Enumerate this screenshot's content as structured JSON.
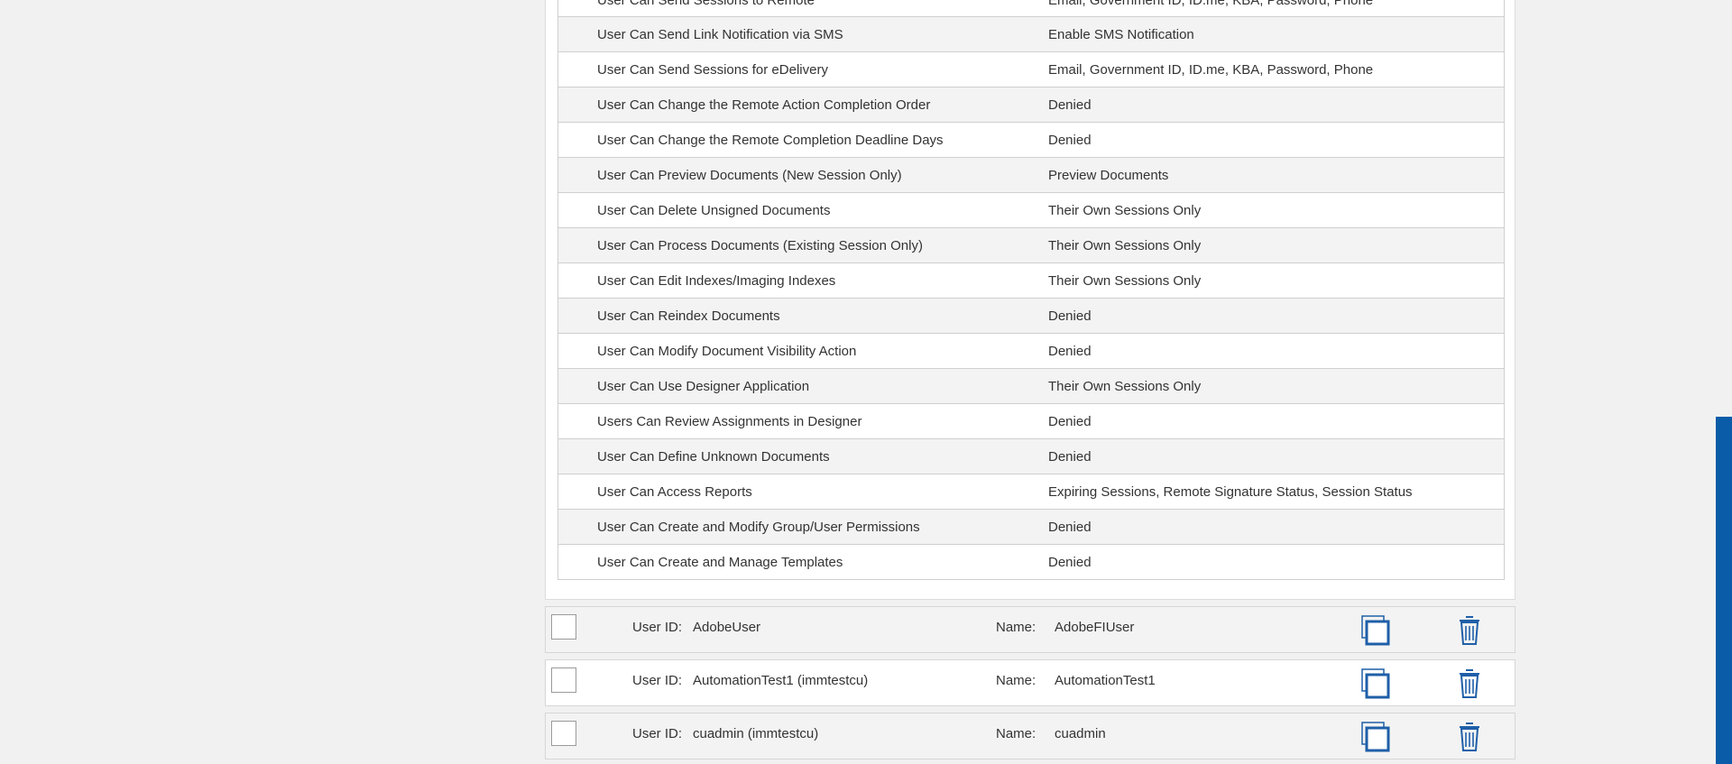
{
  "permissions": [
    {
      "name": "User Can Send Sessions to Remote",
      "value": "Email, Government ID, ID.me, KBA, Password, Phone"
    },
    {
      "name": "User Can Send Link Notification via SMS",
      "value": "Enable SMS Notification"
    },
    {
      "name": "User Can Send Sessions for eDelivery",
      "value": "Email, Government ID, ID.me, KBA, Password, Phone"
    },
    {
      "name": "User Can Change the Remote Action Completion Order",
      "value": "Denied"
    },
    {
      "name": "User Can Change the Remote Completion Deadline Days",
      "value": "Denied"
    },
    {
      "name": "User Can Preview Documents (New Session Only)",
      "value": "Preview Documents"
    },
    {
      "name": "User Can Delete Unsigned Documents",
      "value": "Their Own Sessions Only"
    },
    {
      "name": "User Can Process Documents (Existing Session Only)",
      "value": "Their Own Sessions Only"
    },
    {
      "name": "User Can Edit Indexes/Imaging Indexes",
      "value": "Their Own Sessions Only"
    },
    {
      "name": "User Can Reindex Documents",
      "value": "Denied"
    },
    {
      "name": "User Can Modify Document Visibility Action",
      "value": "Denied"
    },
    {
      "name": "User Can Use Designer Application",
      "value": "Their Own Sessions Only"
    },
    {
      "name": "Users Can Review Assignments in Designer",
      "value": "Denied"
    },
    {
      "name": "User Can Define Unknown Documents",
      "value": "Denied"
    },
    {
      "name": "User Can Access Reports",
      "value": "Expiring Sessions, Remote Signature Status, Session Status"
    },
    {
      "name": "User Can Create and Modify Group/User Permissions",
      "value": "Denied"
    },
    {
      "name": "User Can Create and Manage Templates",
      "value": "Denied"
    }
  ],
  "user_labels": {
    "user_id": "User ID:",
    "name": "Name:"
  },
  "users": [
    {
      "user_id": "AdobeUser",
      "name": "AdobeFIUser"
    },
    {
      "user_id": "AutomationTest1 (immtestcu)",
      "name": "AutomationTest1"
    },
    {
      "user_id": "cuadmin (immtestcu)",
      "name": "cuadmin"
    }
  ],
  "icons": {
    "copy": "copy-icon",
    "delete": "trash-icon"
  },
  "colors": {
    "accent": "#1f5fa8",
    "scrollbar": "#0a5ca8"
  }
}
